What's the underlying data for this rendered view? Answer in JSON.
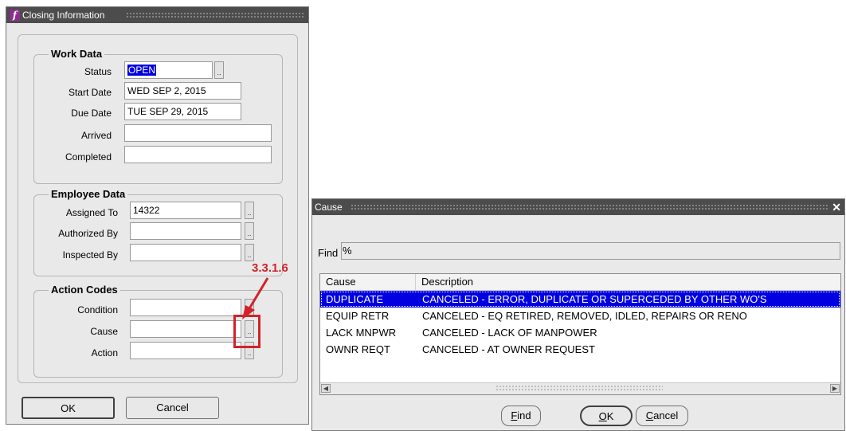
{
  "closing_window": {
    "title": "Closing Information",
    "work_data": {
      "title": "Work Data",
      "status_label": "Status",
      "status_value": "OPEN",
      "start_label": "Start Date",
      "start_value": "WED SEP 2, 2015",
      "due_label": "Due Date",
      "due_value": "TUE SEP 29, 2015",
      "arrived_label": "Arrived",
      "arrived_value": "",
      "completed_label": "Completed",
      "completed_value": ""
    },
    "employee_data": {
      "title": "Employee Data",
      "assigned_label": "Assigned To",
      "assigned_value": "14322",
      "authorized_label": "Authorized By",
      "authorized_value": "",
      "inspected_label": "Inspected By",
      "inspected_value": ""
    },
    "action_codes": {
      "title": "Action Codes",
      "condition_label": "Condition",
      "condition_value": "",
      "cause_label": "Cause",
      "cause_value": "",
      "action_label": "Action",
      "action_value": ""
    },
    "ok_label": "OK",
    "cancel_label": "Cancel",
    "lov_glyph": "..",
    "callout": "3.3.1.6",
    "callout_color": "#d2232a"
  },
  "cause_dialog": {
    "title": "Cause",
    "close_glyph": "✕",
    "find_label": "Find",
    "find_value": "%",
    "columns": [
      "Cause",
      "Description"
    ],
    "rows": [
      {
        "cause": "DUPLICATE",
        "description": "CANCELED - ERROR, DUPLICATE OR SUPERCEDED BY OTHER WO'S"
      },
      {
        "cause": "EQUIP RETR",
        "description": "CANCELED - EQ RETIRED, REMOVED, IDLED, REPAIRS OR RENO"
      },
      {
        "cause": "LACK MNPWR",
        "description": "CANCELED - LACK OF MANPOWER"
      },
      {
        "cause": "OWNR REQT",
        "description": "CANCELED - AT OWNER REQUEST"
      }
    ],
    "find_button": {
      "hotkey": "F",
      "rest": "ind"
    },
    "ok_button": {
      "hotkey": "O",
      "rest": "K"
    },
    "cancel_button": {
      "hotkey": "C",
      "rest": "ancel"
    },
    "selection_color": "#0000e0"
  }
}
